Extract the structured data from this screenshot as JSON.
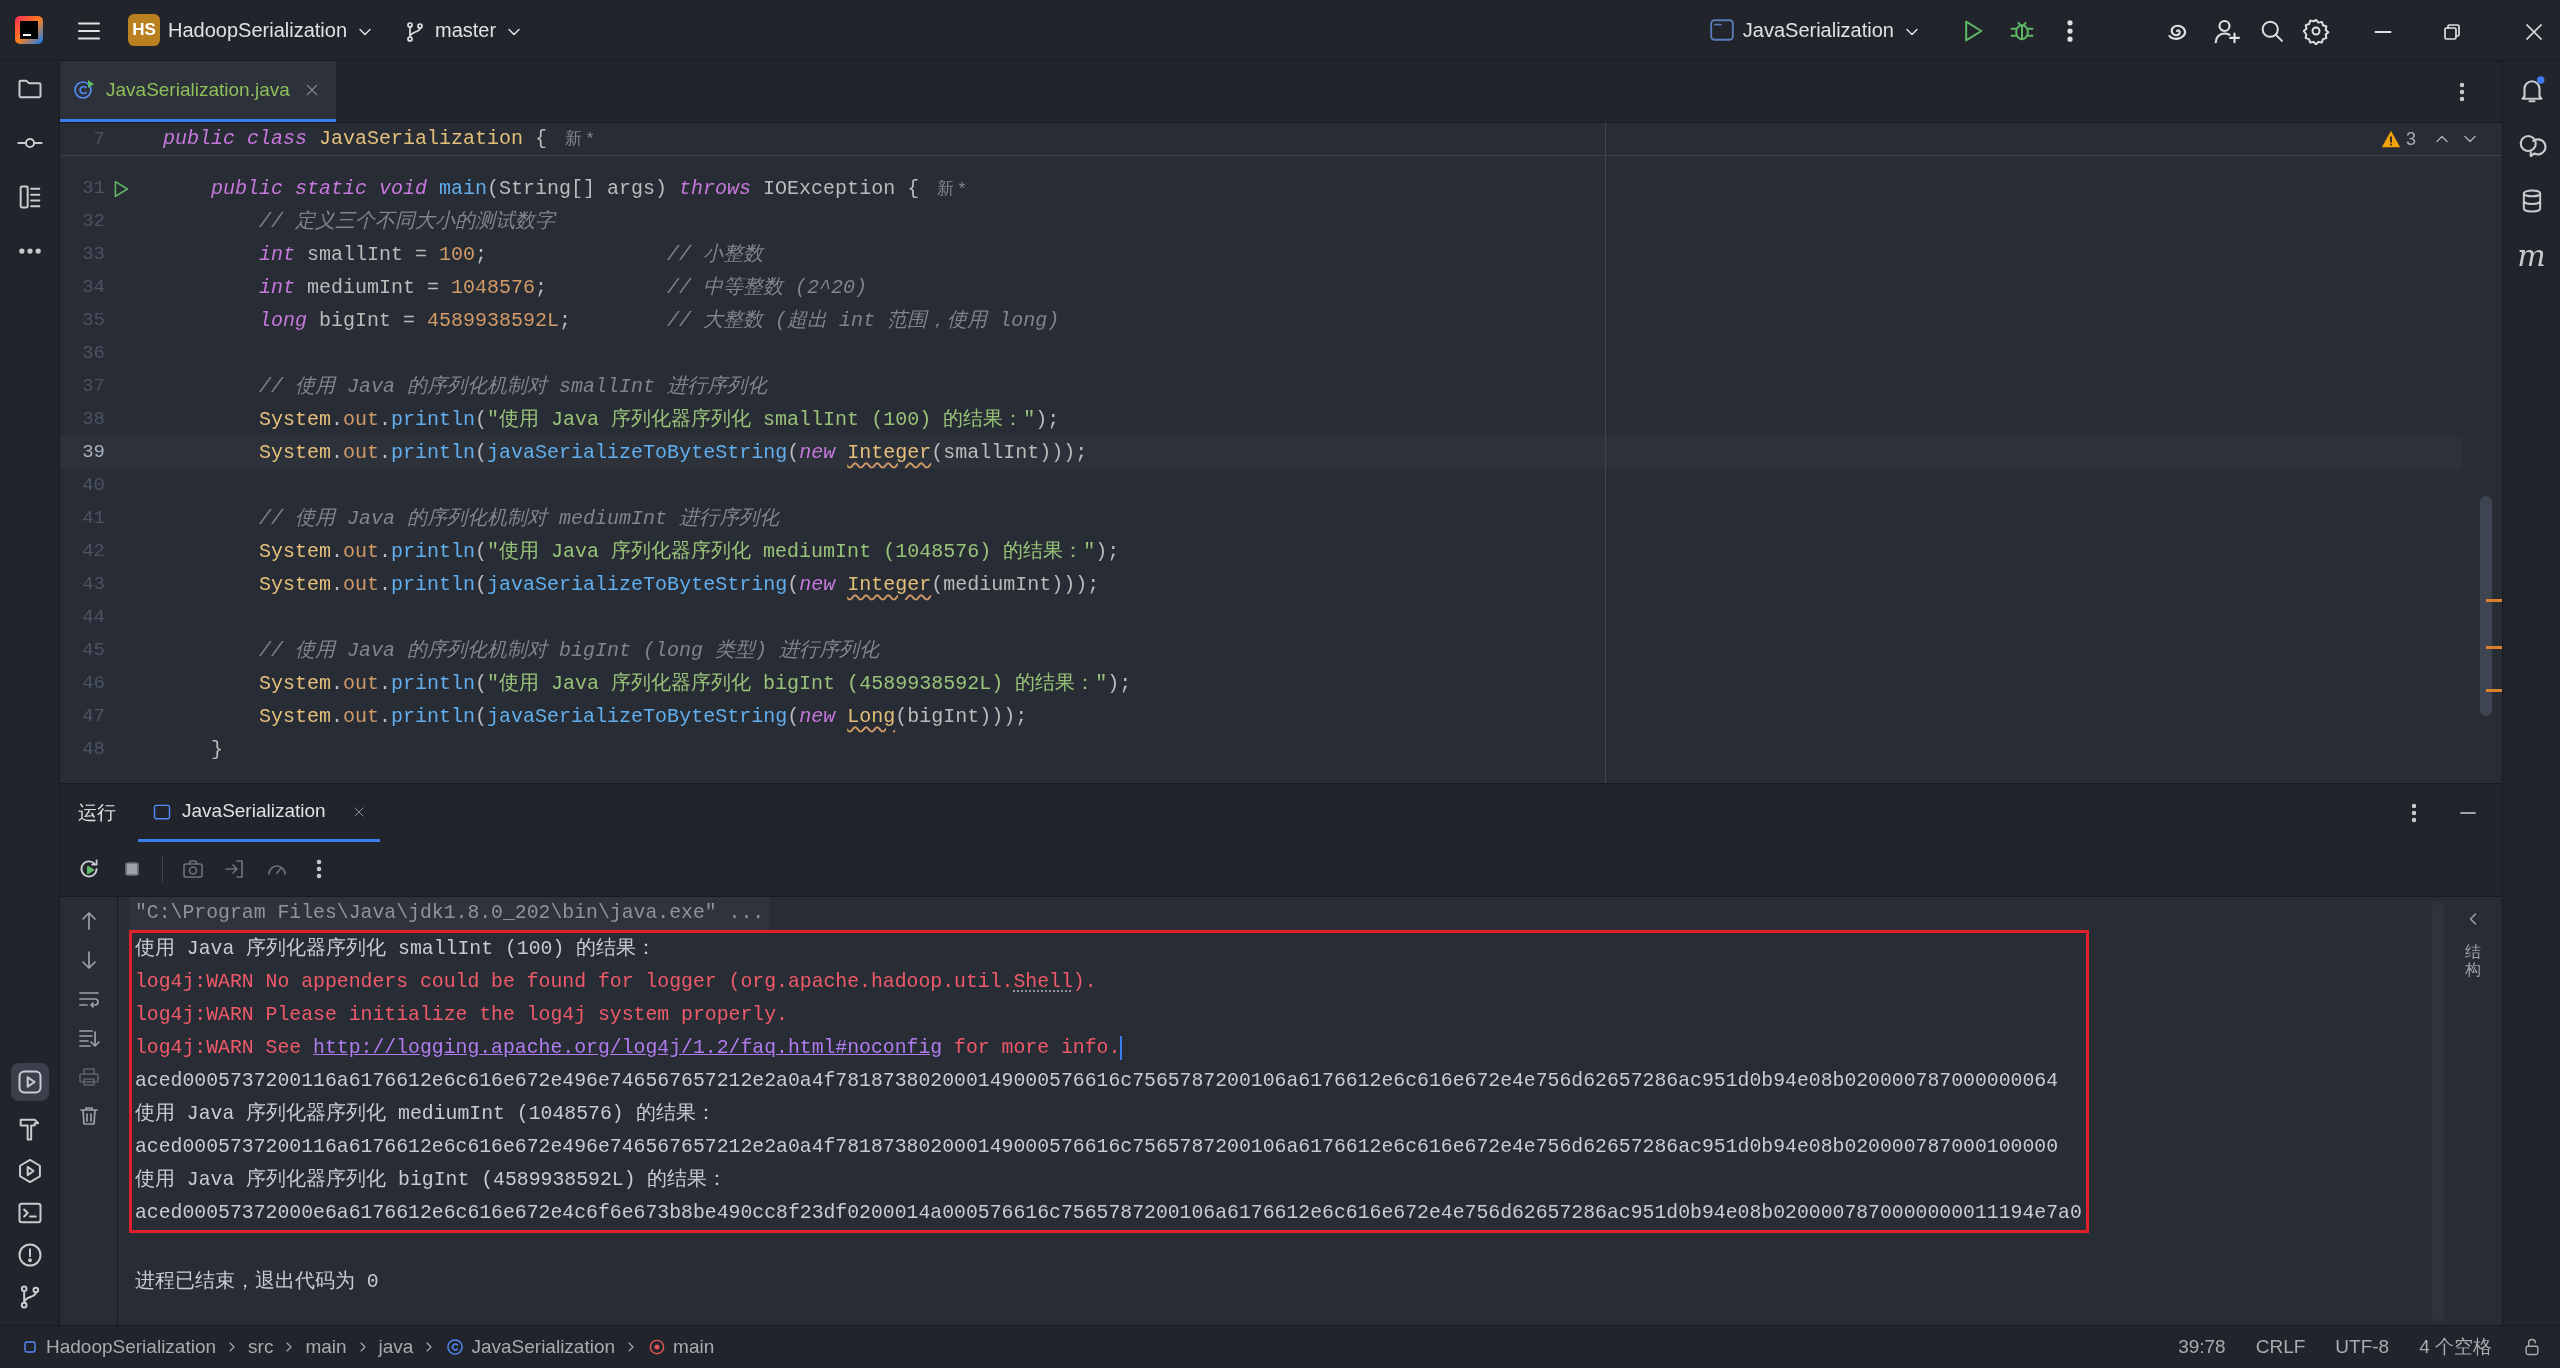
{
  "title_bar": {
    "project_badge": "HS",
    "project": "HadoopSerialization",
    "branch": "master",
    "run_configuration": "JavaSerialization"
  },
  "editor": {
    "tabs": [
      {
        "label": "JavaSerialization.java",
        "selected": true
      }
    ],
    "warning_count": "3",
    "sticky_line": {
      "number": "7",
      "hint": "新 *",
      "tokens": [
        {
          "kind": "keyword",
          "text": "public class "
        },
        {
          "kind": "class",
          "text": "JavaSerialization"
        },
        {
          "kind": "plain",
          "text": " {"
        }
      ]
    },
    "lines": [
      {
        "number": "31",
        "current": false,
        "runnable": true,
        "hint": "新 *",
        "tokens": [
          {
            "kind": "keyword",
            "text": "public static void "
          },
          {
            "kind": "function",
            "text": "main"
          },
          {
            "kind": "plain",
            "text": "(String[] args) "
          },
          {
            "kind": "keyword",
            "text": "throws "
          },
          {
            "kind": "plain",
            "text": "IOException {"
          }
        ],
        "children": [
          {
            "number": "32",
            "current": false,
            "runnable": false,
            "tokens": [
              {
                "kind": "comment",
                "text": "// 定义三个不同大小的测试数字"
              }
            ]
          },
          {
            "number": "33",
            "current": false,
            "runnable": false,
            "tokens": [
              {
                "kind": "keyword",
                "text": "int"
              },
              {
                "kind": "plain",
                "text": " smallInt = "
              },
              {
                "kind": "number",
                "text": "100"
              },
              {
                "kind": "plain",
                "text": ";               "
              },
              {
                "kind": "comment",
                "text": "// 小整数"
              }
            ]
          },
          {
            "number": "34",
            "current": false,
            "runnable": false,
            "tokens": [
              {
                "kind": "keyword",
                "text": "int"
              },
              {
                "kind": "plain",
                "text": " mediumInt = "
              },
              {
                "kind": "number",
                "text": "1048576"
              },
              {
                "kind": "plain",
                "text": ";          "
              },
              {
                "kind": "comment",
                "text": "// 中等整数 (2^20)"
              }
            ]
          },
          {
            "number": "35",
            "current": false,
            "runnable": false,
            "tokens": [
              {
                "kind": "keyword",
                "text": "long"
              },
              {
                "kind": "plain",
                "text": " bigInt = "
              },
              {
                "kind": "number",
                "text": "4589938592L"
              },
              {
                "kind": "plain",
                "text": ";        "
              },
              {
                "kind": "comment",
                "text": "// 大整数 (超出 int 范围，使用 long)"
              }
            ]
          },
          {
            "number": "36",
            "current": false,
            "runnable": false
          },
          {
            "number": "37",
            "current": false,
            "runnable": false,
            "tokens": [
              {
                "kind": "comment",
                "text": "// 使用 Java 的序列化机制对 smallInt 进行序列化"
              }
            ]
          },
          {
            "number": "38",
            "current": false,
            "runnable": false,
            "tokens": [
              {
                "kind": "class",
                "text": "System"
              },
              {
                "kind": "plain",
                "text": "."
              },
              {
                "kind": "field",
                "text": "out"
              },
              {
                "kind": "plain",
                "text": "."
              },
              {
                "kind": "function",
                "text": "println"
              },
              {
                "kind": "plain",
                "text": "("
              },
              {
                "kind": "string",
                "text": "\"使用 Java 序列化器序列化 smallInt (100) 的结果：\""
              },
              {
                "kind": "plain",
                "text": ");"
              }
            ]
          },
          {
            "number": "39",
            "current": true,
            "runnable": false,
            "tokens": [
              {
                "kind": "class",
                "text": "System"
              },
              {
                "kind": "plain",
                "text": "."
              },
              {
                "kind": "field",
                "text": "out"
              },
              {
                "kind": "plain",
                "text": "."
              },
              {
                "kind": "function",
                "text": "println"
              },
              {
                "kind": "plain",
                "text": "("
              },
              {
                "kind": "function",
                "text": "javaSerializeToByteString"
              },
              {
                "kind": "plain",
                "text": "("
              },
              {
                "kind": "keyword",
                "text": "new "
              },
              {
                "kind": "warning",
                "text": "Integer"
              },
              {
                "kind": "plain",
                "text": "(smallInt)));"
              }
            ]
          },
          {
            "number": "40",
            "current": false,
            "runnable": false
          },
          {
            "number": "41",
            "current": false,
            "runnable": false,
            "tokens": [
              {
                "kind": "comment",
                "text": "// 使用 Java 的序列化机制对 mediumInt 进行序列化"
              }
            ]
          },
          {
            "number": "42",
            "current": false,
            "runnable": false,
            "tokens": [
              {
                "kind": "class",
                "text": "System"
              },
              {
                "kind": "plain",
                "text": "."
              },
              {
                "kind": "field",
                "text": "out"
              },
              {
                "kind": "plain",
                "text": "."
              },
              {
                "kind": "function",
                "text": "println"
              },
              {
                "kind": "plain",
                "text": "("
              },
              {
                "kind": "string",
                "text": "\"使用 Java 序列化器序列化 mediumInt (1048576) 的结果：\""
              },
              {
                "kind": "plain",
                "text": ");"
              }
            ]
          },
          {
            "number": "43",
            "current": false,
            "runnable": false,
            "tokens": [
              {
                "kind": "class",
                "text": "System"
              },
              {
                "kind": "plain",
                "text": "."
              },
              {
                "kind": "field",
                "text": "out"
              },
              {
                "kind": "plain",
                "text": "."
              },
              {
                "kind": "function",
                "text": "println"
              },
              {
                "kind": "plain",
                "text": "("
              },
              {
                "kind": "function",
                "text": "javaSerializeToByteString"
              },
              {
                "kind": "plain",
                "text": "("
              },
              {
                "kind": "keyword",
                "text": "new "
              },
              {
                "kind": "warning",
                "text": "Integer"
              },
              {
                "kind": "plain",
                "text": "(mediumInt)));"
              }
            ]
          },
          {
            "number": "44",
            "current": false,
            "runnable": false
          },
          {
            "number": "45",
            "current": false,
            "runnable": false,
            "tokens": [
              {
                "kind": "comment",
                "text": "// 使用 Java 的序列化机制对 bigInt (long 类型) 进行序列化"
              }
            ]
          },
          {
            "number": "46",
            "current": false,
            "runnable": false,
            "tokens": [
              {
                "kind": "class",
                "text": "System"
              },
              {
                "kind": "plain",
                "text": "."
              },
              {
                "kind": "field",
                "text": "out"
              },
              {
                "kind": "plain",
                "text": "."
              },
              {
                "kind": "function",
                "text": "println"
              },
              {
                "kind": "plain",
                "text": "("
              },
              {
                "kind": "string",
                "text": "\"使用 Java 序列化器序列化 bigInt (4589938592L) 的结果：\""
              },
              {
                "kind": "plain",
                "text": ");"
              }
            ]
          },
          {
            "number": "47",
            "current": false,
            "runnable": false,
            "tokens": [
              {
                "kind": "class",
                "text": "System"
              },
              {
                "kind": "plain",
                "text": "."
              },
              {
                "kind": "field",
                "text": "out"
              },
              {
                "kind": "plain",
                "text": "."
              },
              {
                "kind": "function",
                "text": "println"
              },
              {
                "kind": "plain",
                "text": "("
              },
              {
                "kind": "function",
                "text": "javaSerializeToByteString"
              },
              {
                "kind": "plain",
                "text": "("
              },
              {
                "kind": "keyword",
                "text": "new "
              },
              {
                "kind": "warning",
                "text": "Long"
              },
              {
                "kind": "plain",
                "text": "(bigInt)));"
              }
            ]
          }
        ]
      },
      {
        "number": "48",
        "current": false,
        "runnable": false,
        "tokens": [
          {
            "kind": "plain",
            "text": "}"
          }
        ]
      }
    ]
  },
  "run_panel": {
    "title": "运行",
    "tabs": [
      {
        "label": "JavaSerialization",
        "selected": true
      }
    ],
    "command": "\"C:\\Program Files\\Java\\jdk1.8.0_202\\bin\\java.exe\" ...",
    "boxed_output": [
      {
        "kind": "stdout",
        "parts": [
          {
            "kind": "text",
            "text": "使用 Java 序列化器序列化 smallInt (100) 的结果："
          }
        ]
      },
      {
        "kind": "stderr",
        "parts": [
          {
            "kind": "text",
            "text": "log4j:WARN No appenders could be found for logger (org.apache.hadoop.util."
          },
          {
            "kind": "reference",
            "text": "Shell"
          },
          {
            "kind": "text",
            "text": ")."
          }
        ]
      },
      {
        "kind": "stderr",
        "parts": [
          {
            "kind": "text",
            "text": "log4j:WARN Please initialize the log4j system properly."
          }
        ]
      },
      {
        "kind": "stderr",
        "parts": [
          {
            "kind": "text",
            "text": "log4j:WARN See "
          },
          {
            "kind": "link",
            "text": "http://logging.apache.org/log4j/1.2/faq.html#noconfig"
          },
          {
            "kind": "text",
            "text": " for more info."
          },
          {
            "kind": "cursor"
          }
        ]
      },
      {
        "kind": "stdout",
        "parts": [
          {
            "kind": "text",
            "text": "aced0005737200116a6176612e6c616e672e496e746567657212e2a0a4f781873802000149000576616c7565787200106a6176612e6c616e672e4e756d62657286ac951d0b94e08b020000787000000064"
          }
        ]
      },
      {
        "kind": "stdout",
        "parts": [
          {
            "kind": "text",
            "text": "使用 Java 序列化器序列化 mediumInt (1048576) 的结果："
          }
        ]
      },
      {
        "kind": "stdout",
        "parts": [
          {
            "kind": "text",
            "text": "aced0005737200116a6176612e6c616e672e496e746567657212e2a0a4f781873802000149000576616c7565787200106a6176612e6c616e672e4e756d62657286ac951d0b94e08b020000787000100000"
          }
        ]
      },
      {
        "kind": "stdout",
        "parts": [
          {
            "kind": "text",
            "text": "使用 Java 序列化器序列化 bigInt (4589938592L) 的结果："
          }
        ]
      },
      {
        "kind": "stdout",
        "parts": [
          {
            "kind": "text",
            "text": "aced00057372000e6a6176612e6c616e672e4c6f6e673b8be490cc8f23df0200014a000576616c7565787200106a6176612e6c616e672e4e756d62657286ac951d0b94e08b0200007870000000011194e7a0"
          }
        ]
      }
    ],
    "exit_message": "进程已结束，退出代码为 0",
    "side_label": "结构"
  },
  "right_toolbar": {
    "letter_button": "m"
  },
  "status_bar": {
    "breadcrumbs": [
      {
        "kind": "module",
        "label": "HadoopSerialization"
      },
      {
        "kind": "folder",
        "label": "src"
      },
      {
        "kind": "folder",
        "label": "main"
      },
      {
        "kind": "folder",
        "label": "java"
      },
      {
        "kind": "class",
        "label": "JavaSerialization"
      },
      {
        "kind": "method",
        "label": "main"
      }
    ],
    "position": "39:78",
    "line_ending": "CRLF",
    "encoding": "UTF-8",
    "indent": "4 个空格"
  }
}
